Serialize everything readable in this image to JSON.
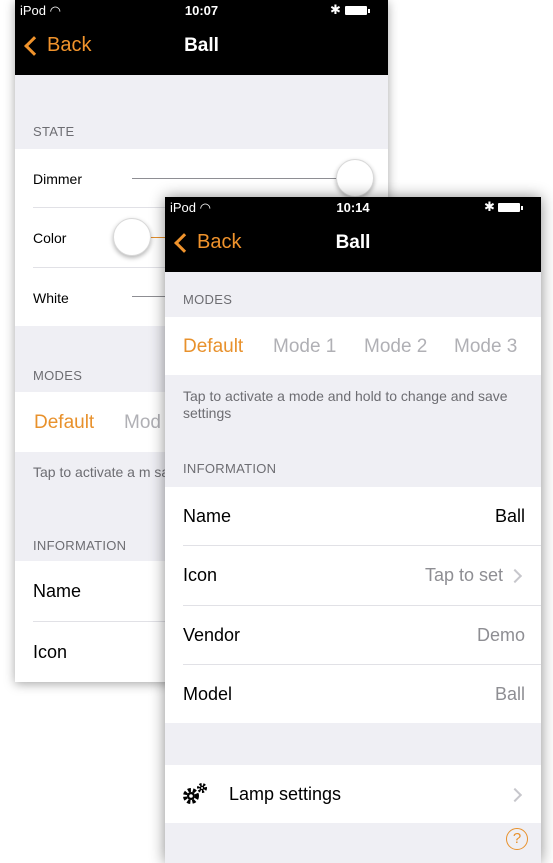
{
  "back_screen": {
    "status": {
      "carrier": "iPod",
      "time": "10:07",
      "bluetooth": "✱"
    },
    "nav": {
      "back": "Back",
      "title": "Ball"
    },
    "state_header": "STATE",
    "sliders": [
      {
        "label": "Dimmer",
        "value": 1.0
      },
      {
        "label": "Color",
        "value": 0.0
      },
      {
        "label": "White"
      }
    ],
    "modes_header": "MODES",
    "modes": [
      "Default",
      "Mod"
    ],
    "modes_footer": "Tap to activate a m save settings",
    "info_header": "INFORMATION",
    "info_rows": [
      {
        "label": "Name"
      },
      {
        "label": "Icon"
      }
    ]
  },
  "front_screen": {
    "status": {
      "carrier": "iPod",
      "time": "10:14",
      "bluetooth": "✱"
    },
    "nav": {
      "back": "Back",
      "title": "Ball"
    },
    "modes_header": "MODES",
    "modes": [
      "Default",
      "Mode 1",
      "Mode 2",
      "Mode 3"
    ],
    "active_mode": "Default",
    "modes_footer": "Tap to activate a mode and hold to change and save settings",
    "info_header": "INFORMATION",
    "info_rows": [
      {
        "label": "Name",
        "value": "Ball"
      },
      {
        "label": "Icon",
        "value": "Tap to set"
      },
      {
        "label": "Vendor",
        "value": "Demo"
      },
      {
        "label": "Model",
        "value": "Ball"
      }
    ],
    "lamp_settings": "Lamp settings",
    "help": "?"
  },
  "colors": {
    "accent": "#e8912c",
    "bar": "#000000",
    "background": "#efeff4"
  }
}
